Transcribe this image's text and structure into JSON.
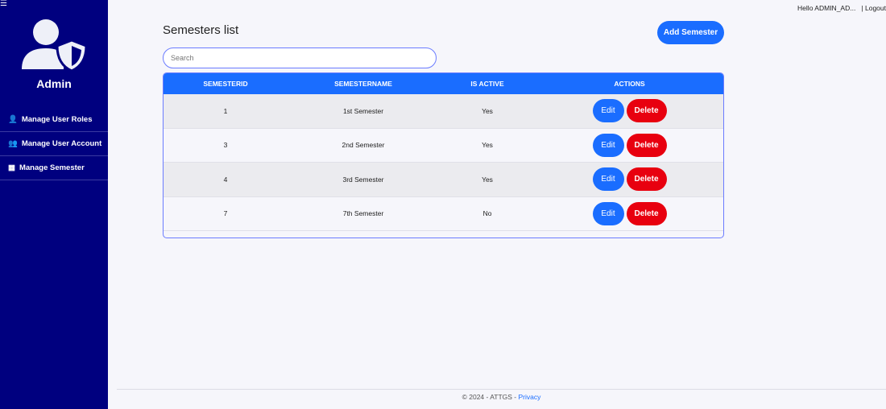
{
  "sidebar": {
    "user_label": "Admin",
    "items": [
      {
        "label": "Manage User Roles",
        "icon": "user-gear-icon"
      },
      {
        "label": "Manage User Account",
        "icon": "users-icon"
      },
      {
        "label": "Manage Semester",
        "icon": "calendar-icon"
      }
    ]
  },
  "header": {
    "greeting": "Hello ADMIN_AD...",
    "logout": "| Logout"
  },
  "main": {
    "title": "Semesters list",
    "add_label": "Add Semester",
    "search_placeholder": "Search",
    "columns": [
      "SEMESTERID",
      "SEMESTERNAME",
      "IS ACTIVE",
      "ACTIONS"
    ],
    "rows": [
      {
        "id": "1",
        "name": "1st Semester",
        "active": "Yes"
      },
      {
        "id": "3",
        "name": "2nd Semester",
        "active": "Yes"
      },
      {
        "id": "4",
        "name": "3rd Semester",
        "active": "Yes"
      },
      {
        "id": "7",
        "name": "7th Semester",
        "active": "No"
      }
    ],
    "edit_label": "Edit",
    "delete_label": "Delete"
  },
  "footer": {
    "text": "© 2024 - ATTGS - ",
    "privacy": "Privacy"
  },
  "colors": {
    "sidebar": "#00007f",
    "primary": "#1a6dff",
    "danger": "#e8000f"
  }
}
